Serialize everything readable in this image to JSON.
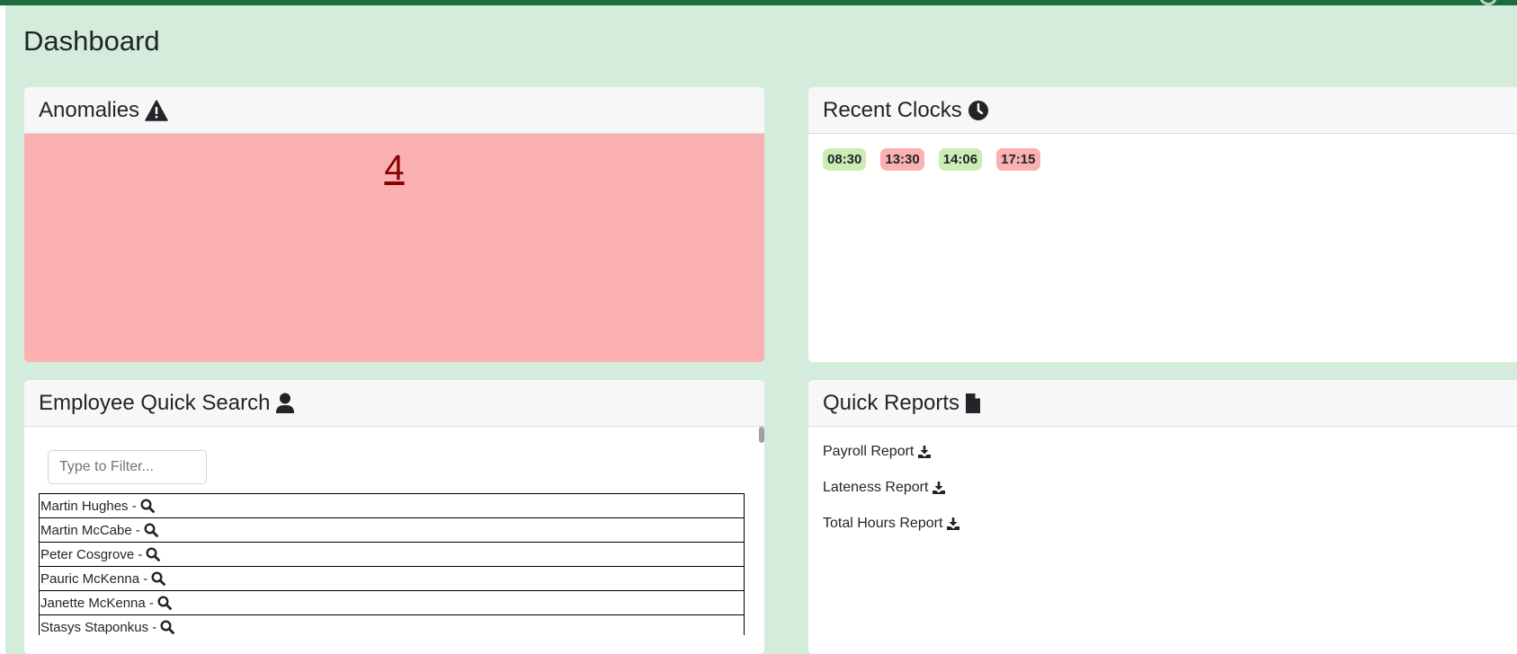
{
  "page": {
    "title": "Dashboard"
  },
  "anomalies": {
    "title": "Anomalies",
    "icon": "warning-triangle-icon",
    "count": "4",
    "background": "#fbb0b1",
    "count_color": "#8b0000"
  },
  "recent_clocks": {
    "title": "Recent Clocks",
    "icon": "clock-icon",
    "entries": [
      {
        "time": "08:30",
        "status": "in"
      },
      {
        "time": "13:30",
        "status": "out"
      },
      {
        "time": "14:06",
        "status": "in"
      },
      {
        "time": "17:15",
        "status": "out"
      }
    ],
    "in_color": "#cbecb5",
    "out_color": "#fbb0b1"
  },
  "employee_search": {
    "title": "Employee Quick Search",
    "icon": "user-icon",
    "filter_placeholder": "Type to Filter...",
    "employees": [
      "Martin Hughes - ",
      "Martin McCabe - ",
      "Peter Cosgrove - ",
      "Pauric McKenna - ",
      "Janette McKenna - ",
      "Stasys Staponkus - "
    ]
  },
  "quick_reports": {
    "title": "Quick Reports",
    "icon": "file-icon",
    "reports": [
      "Payroll Report",
      "Lateness Report",
      "Total Hours Report"
    ]
  },
  "colors": {
    "topbar": "#1e6b3c",
    "page_background": "#d4ecdc"
  }
}
